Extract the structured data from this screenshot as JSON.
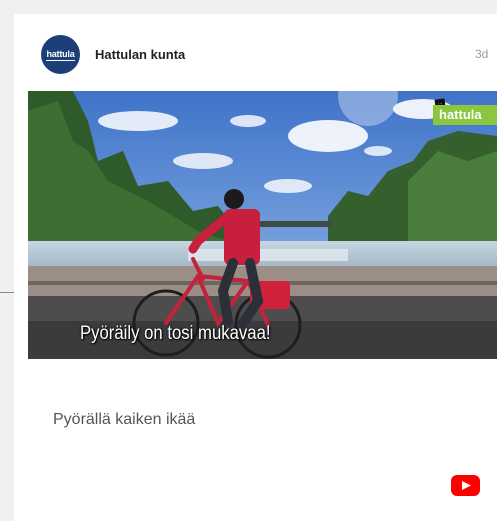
{
  "post": {
    "page_name": "Hattulan kunta",
    "avatar_text": "hattula",
    "timestamp": "3d",
    "video": {
      "caption": "Pyöräily on tosi mukavaa!",
      "logo_text": "hattula",
      "logo_small_text": "..."
    },
    "title": "Pyörällä kaiken ikää",
    "source_icon": "youtube-icon"
  },
  "colors": {
    "avatar_bg": "#1d3f78",
    "logo_green": "#8cc63f",
    "youtube_red": "#ff0000"
  }
}
